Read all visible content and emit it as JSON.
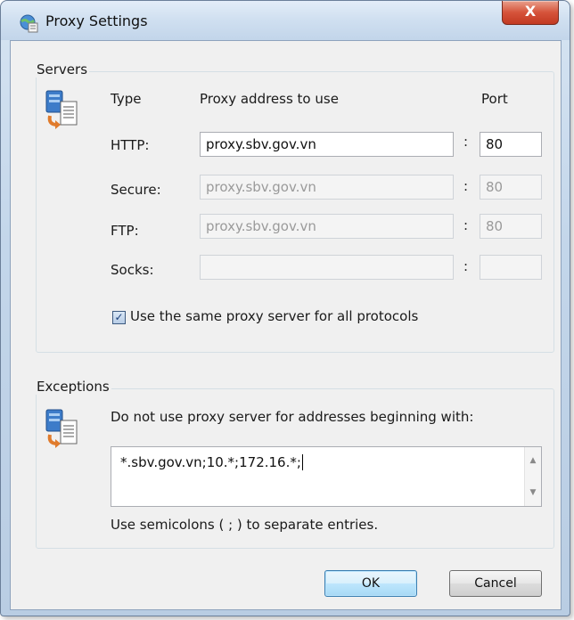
{
  "window": {
    "title": "Proxy Settings",
    "close_label": "X"
  },
  "servers": {
    "group_label": "Servers",
    "col_type": "Type",
    "col_address": "Proxy address to use",
    "col_port": "Port",
    "rows": [
      {
        "type": "HTTP:",
        "address": "proxy.sbv.gov.vn",
        "port": "80",
        "enabled": true
      },
      {
        "type": "Secure:",
        "address": "proxy.sbv.gov.vn",
        "port": "80",
        "enabled": false
      },
      {
        "type": "FTP:",
        "address": "proxy.sbv.gov.vn",
        "port": "80",
        "enabled": false
      },
      {
        "type": "Socks:",
        "address": "",
        "port": "",
        "enabled": false
      }
    ],
    "colon": ":",
    "same_proxy_checked": true,
    "same_proxy_label": "Use the same proxy server for all protocols"
  },
  "exceptions": {
    "group_label": "Exceptions",
    "instruction": "Do not use proxy server for addresses beginning with:",
    "value": "*.sbv.gov.vn;10.*;172.16.*;",
    "hint": "Use semicolons ( ; ) to separate entries."
  },
  "buttons": {
    "ok": "OK",
    "cancel": "Cancel"
  },
  "icons": {
    "title": "globe-network-icon",
    "servers": "server-document-icon",
    "exceptions": "server-document-icon"
  }
}
